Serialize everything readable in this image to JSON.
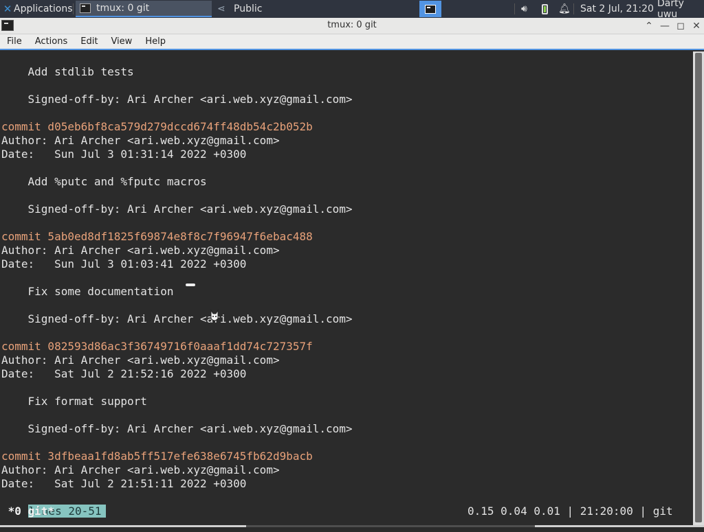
{
  "panel": {
    "apps_label": "Applications",
    "tasks": [
      {
        "label": "tmux: 0 git"
      },
      {
        "label": "Public"
      }
    ],
    "clock": "Sat  2 Jul, 21:20",
    "user": "Darty uwu",
    "icons": [
      "volume-icon",
      "battery-icon",
      "notification-bell-icon"
    ]
  },
  "window": {
    "title": "tmux: 0 git",
    "buttons": [
      "maximize-up-icon",
      "minimize-icon",
      "restore-icon",
      "close-icon"
    ]
  },
  "menu": [
    "File",
    "Actions",
    "Edit",
    "View",
    "Help"
  ],
  "terminal": {
    "lines": [
      {
        "text": "    Add stdlib tests",
        "type": "text"
      },
      {
        "text": "",
        "type": "text"
      },
      {
        "text": "    Signed-off-by: Ari Archer <ari.web.xyz@gmail.com>",
        "type": "text"
      },
      {
        "text": "",
        "type": "text"
      },
      {
        "text": "commit d05eb6bf8ca579d279dccd674ff48db54c2b052b",
        "type": "commit"
      },
      {
        "text": "Author: Ari Archer <ari.web.xyz@gmail.com>",
        "type": "text"
      },
      {
        "text": "Date:   Sun Jul 3 01:31:14 2022 +0300",
        "type": "text"
      },
      {
        "text": "",
        "type": "text"
      },
      {
        "text": "    Add %putc and %fputc macros",
        "type": "text"
      },
      {
        "text": "",
        "type": "text"
      },
      {
        "text": "    Signed-off-by: Ari Archer <ari.web.xyz@gmail.com>",
        "type": "text"
      },
      {
        "text": "",
        "type": "text"
      },
      {
        "text": "commit 5ab0ed8df1825f69874e8f8c7f96947f6ebac488",
        "type": "commit"
      },
      {
        "text": "Author: Ari Archer <ari.web.xyz@gmail.com>",
        "type": "text"
      },
      {
        "text": "Date:   Sun Jul 3 01:03:41 2022 +0300",
        "type": "text"
      },
      {
        "text": "",
        "type": "text"
      },
      {
        "text": "    Fix some documentation",
        "type": "text"
      },
      {
        "text": "",
        "type": "text"
      },
      {
        "text": "    Signed-off-by: Ari Archer <ari.web.xyz@gmail.com>",
        "type": "text"
      },
      {
        "text": "",
        "type": "text"
      },
      {
        "text": "commit 082593d86ac3f36749716f0aaaf1dd74c727357f",
        "type": "commit"
      },
      {
        "text": "Author: Ari Archer <ari.web.xyz@gmail.com>",
        "type": "text"
      },
      {
        "text": "Date:   Sat Jul 2 21:52:16 2022 +0300",
        "type": "text"
      },
      {
        "text": "",
        "type": "text"
      },
      {
        "text": "    Fix format support",
        "type": "text"
      },
      {
        "text": "",
        "type": "text"
      },
      {
        "text": "    Signed-off-by: Ari Archer <ari.web.xyz@gmail.com>",
        "type": "text"
      },
      {
        "text": "",
        "type": "text"
      },
      {
        "text": "commit 3dfbeaa1fd8ab5ff517efe638e6745fb62d9bacb",
        "type": "commit"
      },
      {
        "text": "Author: Ari Archer <ari.web.xyz@gmail.com>",
        "type": "text"
      },
      {
        "text": "Date:   Sat Jul 2 21:51:11 2022 +0300",
        "type": "text"
      }
    ],
    "pager_status": "lines 20-51",
    "tmux_window": " *0 git*",
    "tmux_right": "0.15 0.04 0.01 | 21:20:00 | git"
  },
  "colors": {
    "commit": "#e9a27a",
    "terminal_bg": "#2b2b2b",
    "pager_highlight": "#86c4c0",
    "accent": "#5294e2"
  }
}
